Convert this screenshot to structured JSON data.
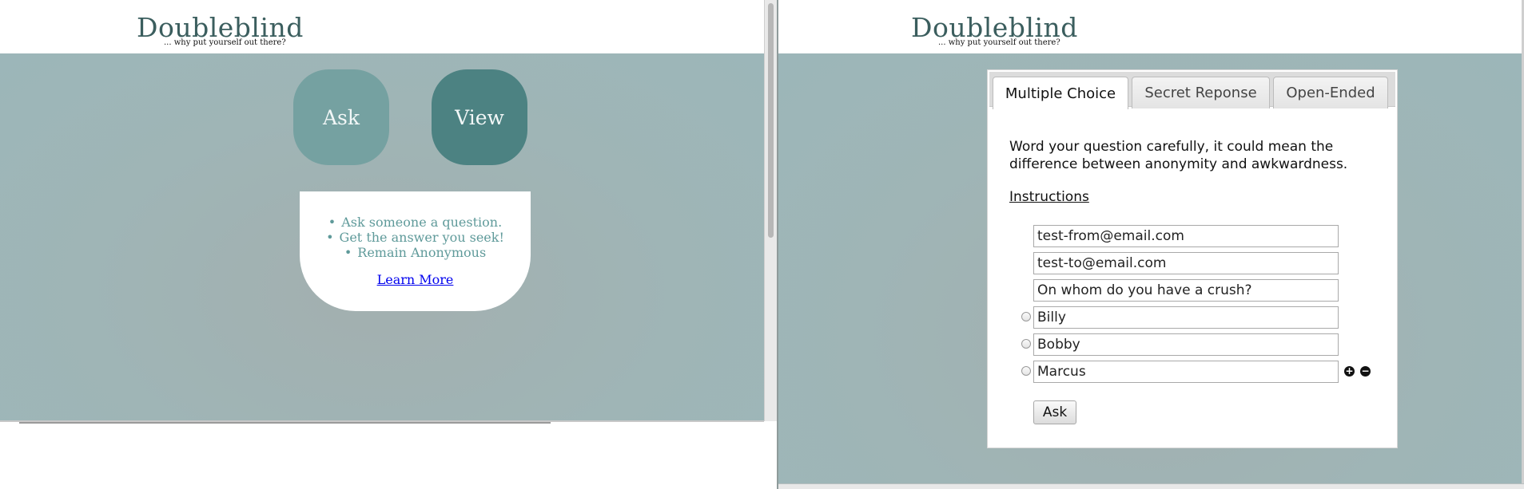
{
  "site": {
    "logo": "Doubleblind",
    "tagline": "... why put yourself out there?"
  },
  "home": {
    "ask_label": "Ask",
    "view_label": "View",
    "bullets": [
      "Ask someone a question.",
      "Get the answer you seek!",
      "Remain Anonymous"
    ],
    "learn_more": "Learn More"
  },
  "ask_form": {
    "tabs": [
      {
        "label": "Multiple Choice",
        "active": true
      },
      {
        "label": "Secret Reponse",
        "active": false
      },
      {
        "label": "Open-Ended",
        "active": false
      }
    ],
    "intro": "Word your question carefully, it could mean the difference between anonymity and awkwardness.",
    "instructions_link": "Instructions",
    "from_email": "test-from@email.com",
    "to_email": "test-to@email.com",
    "question": "On whom do you have a crush?",
    "choices": [
      "Billy",
      "Bobby",
      "Marcus"
    ],
    "add_icon": "plus-circle-icon",
    "remove_icon": "minus-circle-icon",
    "submit_label": "Ask"
  },
  "colors": {
    "background": "#9fb5b6",
    "logo": "#3b5e5e",
    "ask_button": "#75a1a1",
    "view_button": "#4c8282",
    "bullet_text": "#5f9a9a",
    "link": "#0000ee"
  }
}
